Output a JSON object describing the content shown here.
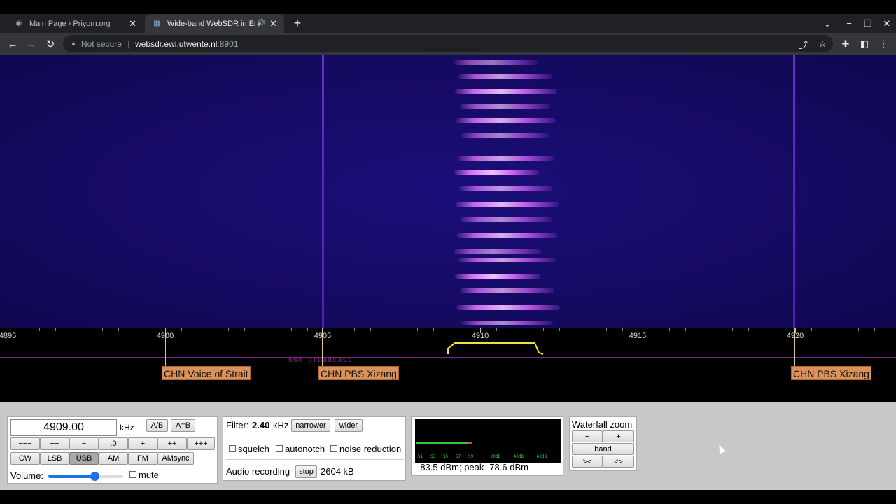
{
  "browser": {
    "tabs": [
      {
        "title": "Main Page › Priyom.org",
        "active": false
      },
      {
        "title": "Wide-band WebSDR in Ensch",
        "active": true
      }
    ],
    "security_label": "Not secure",
    "url_host": "websdr.ewi.utwente.nl",
    "url_port": ":8901"
  },
  "scale": {
    "ticks": [
      "4895",
      "4900",
      "4905",
      "4910",
      "4915",
      "4920"
    ],
    "band_name": "60m broadcast",
    "stations": [
      "CHN Voice of Strait",
      "CHN PBS Xizang",
      "CHN PBS Xizang"
    ]
  },
  "frequency": {
    "value": "4909.00",
    "unit": "kHz",
    "ab_label": "A/B",
    "aeqb_label": "A=B",
    "steps": [
      "−−−",
      "−−",
      "−",
      ".0",
      "+",
      "++",
      "+++"
    ],
    "modes": [
      "CW",
      "LSB",
      "USB",
      "AM",
      "FM",
      "AMsync"
    ],
    "active_mode": "USB",
    "volume_label": "Volume:",
    "volume_level": 0.62,
    "mute_label": "mute"
  },
  "filter": {
    "label": "Filter:",
    "value": "2.40",
    "unit": "kHz",
    "narrower_label": "narrower",
    "wider_label": "wider",
    "squelch_label": "squelch",
    "autonotch_label": "autonotch",
    "noise_reduction_label": "noise reduction",
    "recording_label": "Audio recording",
    "stop_label": "stop",
    "recording_size": "2604 kB"
  },
  "smeter": {
    "scale": [
      "S1",
      "S3",
      "S5",
      "S7",
      "S9",
      "+20dB",
      "+40dB",
      "+60dB"
    ],
    "level_fraction": 0.36,
    "readout": "-83.5 dBm; peak  -78.6 dBm"
  },
  "waterfall_zoom": {
    "title": "Waterfall zoom",
    "minus_label": "−",
    "plus_label": "+",
    "band_label": "band",
    "narrow_label": "><",
    "wide_label": "<>"
  },
  "colors": {
    "waterfall_bg": "#150a62",
    "signal": "#d36cf4",
    "station_label": "#d9925a",
    "passband": "#f0e040",
    "band_line": "#8a1f8a"
  }
}
